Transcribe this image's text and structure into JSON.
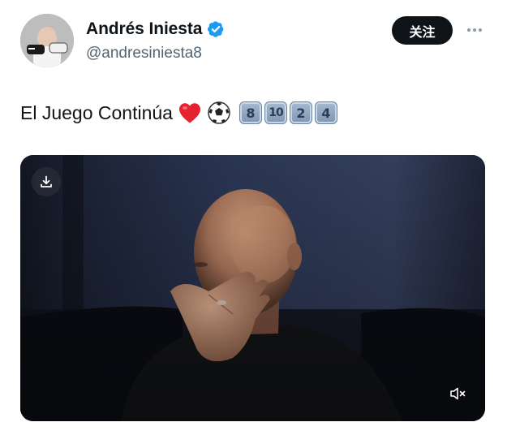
{
  "author": {
    "display_name": "Andrés Iniesta",
    "handle": "@andresiniesta8",
    "verified": true,
    "avatar_icon": "user-avatar"
  },
  "actions": {
    "follow_label": "关注",
    "more_icon": "more-horizontal-icon"
  },
  "tweet": {
    "text": "El Juego Continúa",
    "emoji": [
      "red-heart",
      "soccer-ball"
    ],
    "keycaps": [
      "8",
      "10",
      "2",
      "4"
    ]
  },
  "media": {
    "type": "video",
    "download_icon": "download-icon",
    "mute_icon": "speaker-muted-icon"
  },
  "colors": {
    "text_primary": "#0f1419",
    "text_secondary": "#536471",
    "verified_blue": "#1d9bf0",
    "follow_bg": "#0f1419",
    "keycap_blue": "#8aa1bd"
  }
}
